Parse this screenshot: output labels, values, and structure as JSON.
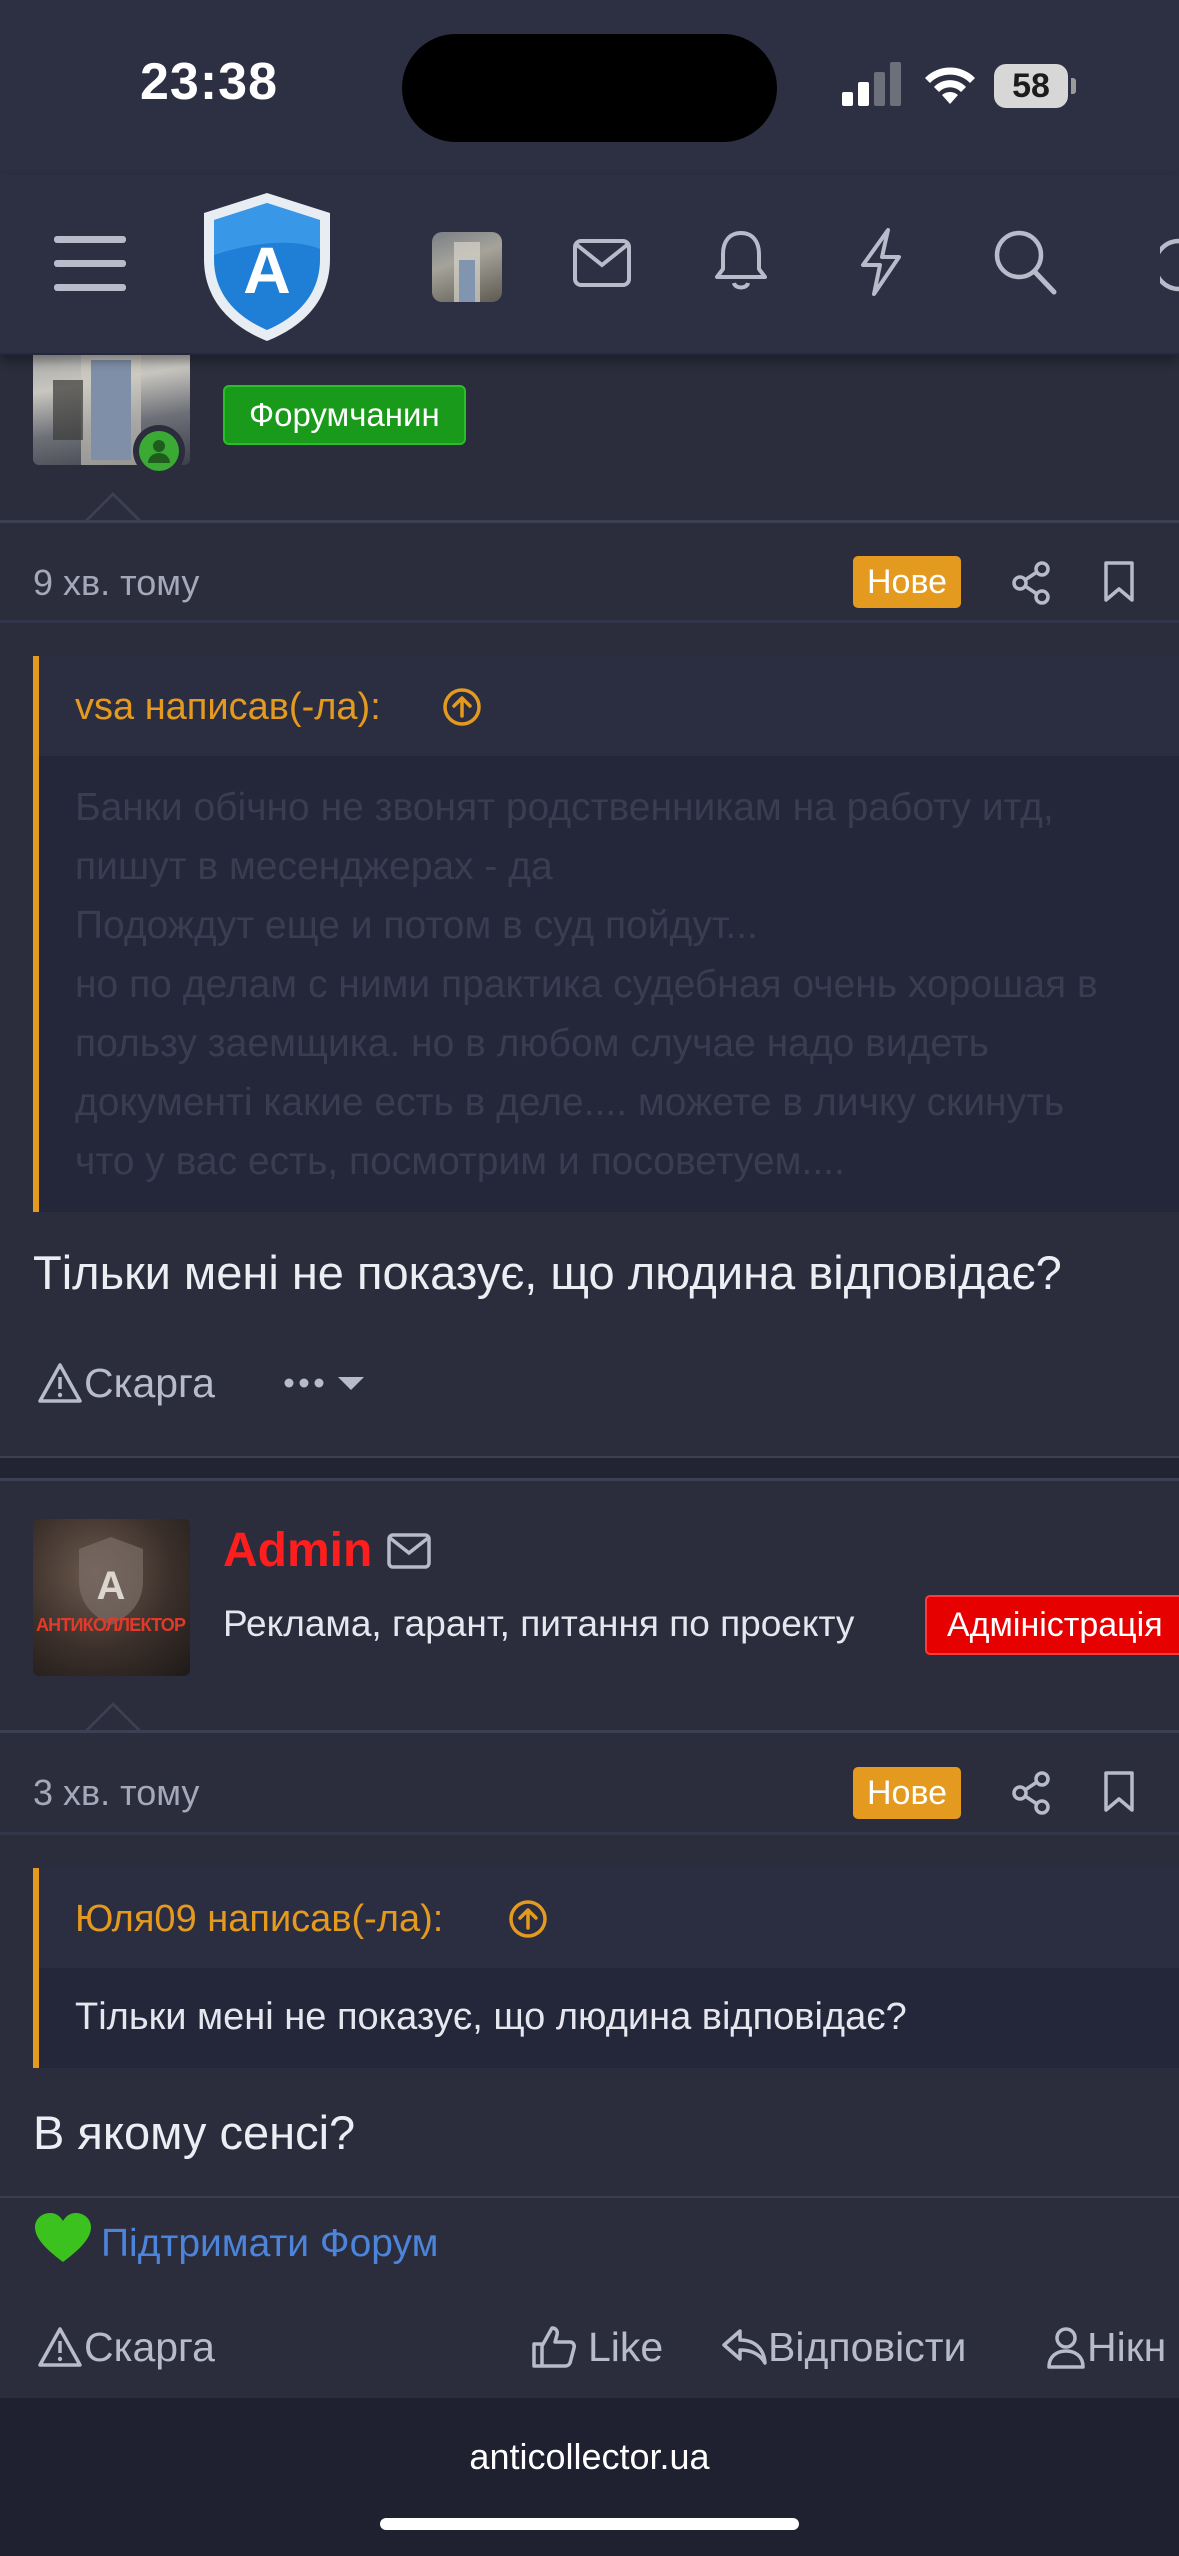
{
  "status_bar": {
    "time": "23:38",
    "battery": "58"
  },
  "post1": {
    "badge": "Форумчанин",
    "time": "9 хв. тому",
    "new_label": "Нове",
    "quote_author": "vsa написав(-ла):",
    "quote_lines": [
      "Банки обічно не звонят родственникам на работу итд,",
      "пишут в месенджерах - да",
      "Подождут еще и потом в суд пойдут...",
      "но по делам с ними практика судебная очень хорошая в",
      "пользу заемщика. но в любом случае надо видеть",
      "документі какие есть в деле.... можете в личку скинуть",
      "что у вас есть, посмотрим и посоветуем...."
    ],
    "message": "Тільки мені не показує, що людина відповідає?",
    "report_label": "Скарга"
  },
  "post2": {
    "name": "Admin",
    "user_title": "Реклама, гарант, питання по проекту",
    "badge": "Адміністрація",
    "avatar_text": "АНТИКОЛЛЕКТОР",
    "avatar_letter": "A",
    "time": "3 хв. тому",
    "new_label": "Нове",
    "quote_author": "Юля09 написав(-ла):",
    "quote_text": "Тільки мені не показує, що людина відповідає?",
    "message": "В якому сенсі?",
    "support_link": "Підтримати Форум",
    "report_label": "Скарга",
    "like_label": "Like",
    "reply_label": "Відповісти",
    "nick_label": "Нікн"
  },
  "browser": {
    "url": "anticollector.ua"
  },
  "logo_letter": "A",
  "colors": {
    "accent_orange": "#e39a1f",
    "admin_red": "#ff1e1e",
    "badge_green": "#1a9a1a",
    "link_blue": "#4c84d9",
    "background": "#2b2d3d"
  },
  "icons": [
    "menu-icon",
    "shield-logo-icon",
    "mail-icon",
    "bell-icon",
    "lightning-icon",
    "search-icon",
    "share-icon",
    "bookmark-icon",
    "warning-icon",
    "more-icon",
    "heart-icon",
    "thumbs-up-icon",
    "reply-icon",
    "user-icon"
  ]
}
